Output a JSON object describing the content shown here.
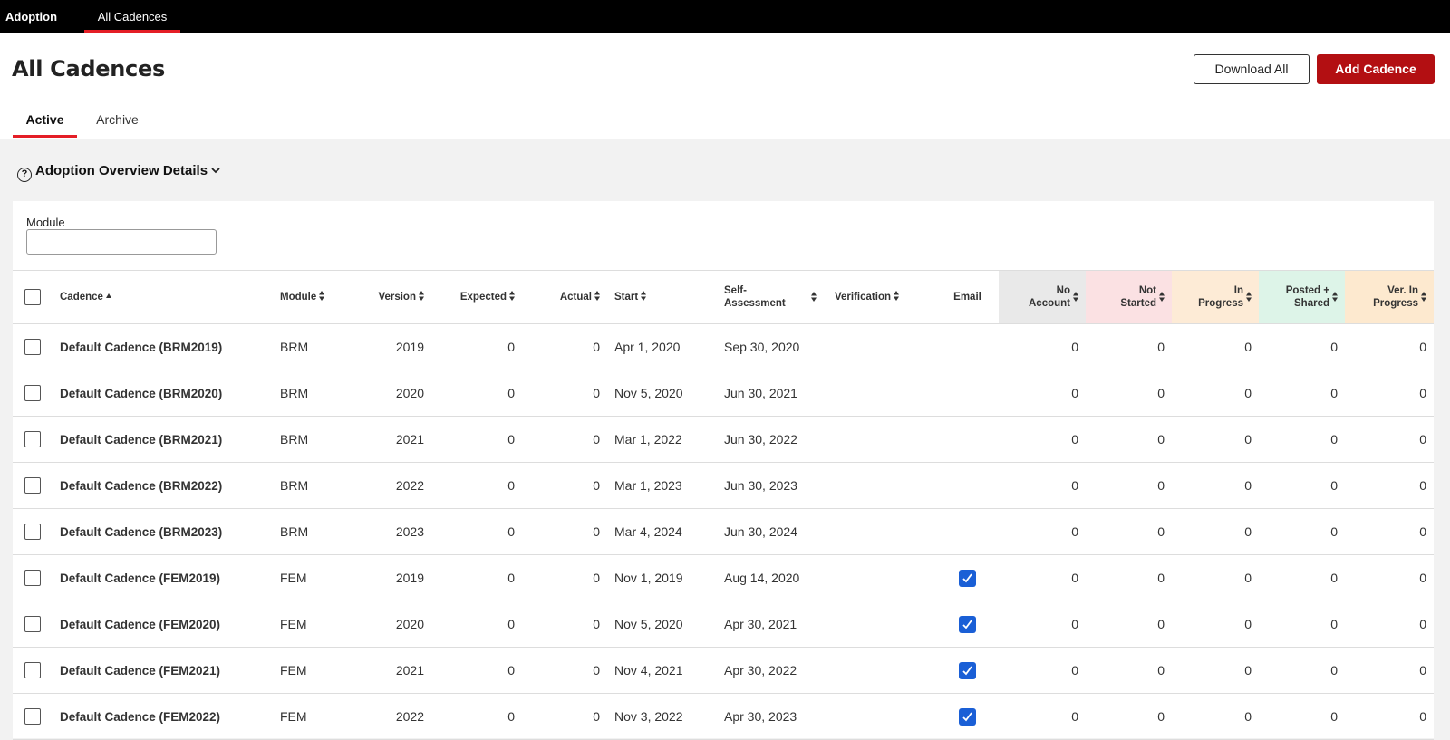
{
  "topnav": {
    "brand": "Adoption",
    "tab": "All Cadences"
  },
  "page": {
    "title": "All Cadences",
    "download_label": "Download All",
    "add_label": "Add Cadence"
  },
  "tabs": [
    {
      "label": "Active",
      "active": true
    },
    {
      "label": "Archive",
      "active": false
    }
  ],
  "overview": {
    "label": "Adoption Overview Details"
  },
  "filter": {
    "module_label": "Module",
    "module_value": ""
  },
  "colors": {
    "accent_red": "#e41e26",
    "button_red": "#b30f12",
    "checkbox_blue": "#1a5fd6",
    "no_account_bg": "#e9e9e9",
    "not_started_bg": "#fbe1e3",
    "in_progress_bg": "#fdebd6",
    "posted_shared_bg": "#ddf4e8",
    "ver_in_progress_bg": "#fde9cf"
  },
  "table": {
    "headers": {
      "cadence": "Cadence",
      "module": "Module",
      "version": "Version",
      "expected": "Expected",
      "actual": "Actual",
      "start": "Start",
      "self_assessment": "Self-Assessment",
      "verification": "Verification",
      "email": "Email",
      "no_account": "No Account",
      "not_started": "Not Started",
      "in_progress": "In Progress",
      "posted_shared": "Posted + Shared",
      "ver_in_progress": "Ver. In Progress"
    },
    "rows": [
      {
        "cadence": "Default Cadence (BRM2019)",
        "module": "BRM",
        "version": "2019",
        "expected": "0",
        "actual": "0",
        "start": "Apr 1, 2020",
        "self_assessment": "Sep 30, 2020",
        "verification": "",
        "email": false,
        "no_account": "0",
        "not_started": "0",
        "in_progress": "0",
        "posted_shared": "0",
        "ver_in_progress": "0"
      },
      {
        "cadence": "Default Cadence (BRM2020)",
        "module": "BRM",
        "version": "2020",
        "expected": "0",
        "actual": "0",
        "start": "Nov 5, 2020",
        "self_assessment": "Jun 30, 2021",
        "verification": "",
        "email": false,
        "no_account": "0",
        "not_started": "0",
        "in_progress": "0",
        "posted_shared": "0",
        "ver_in_progress": "0"
      },
      {
        "cadence": "Default Cadence (BRM2021)",
        "module": "BRM",
        "version": "2021",
        "expected": "0",
        "actual": "0",
        "start": "Mar 1, 2022",
        "self_assessment": "Jun 30, 2022",
        "verification": "",
        "email": false,
        "no_account": "0",
        "not_started": "0",
        "in_progress": "0",
        "posted_shared": "0",
        "ver_in_progress": "0"
      },
      {
        "cadence": "Default Cadence (BRM2022)",
        "module": "BRM",
        "version": "2022",
        "expected": "0",
        "actual": "0",
        "start": "Mar 1, 2023",
        "self_assessment": "Jun 30, 2023",
        "verification": "",
        "email": false,
        "no_account": "0",
        "not_started": "0",
        "in_progress": "0",
        "posted_shared": "0",
        "ver_in_progress": "0"
      },
      {
        "cadence": "Default Cadence (BRM2023)",
        "module": "BRM",
        "version": "2023",
        "expected": "0",
        "actual": "0",
        "start": "Mar 4, 2024",
        "self_assessment": "Jun 30, 2024",
        "verification": "",
        "email": false,
        "no_account": "0",
        "not_started": "0",
        "in_progress": "0",
        "posted_shared": "0",
        "ver_in_progress": "0"
      },
      {
        "cadence": "Default Cadence (FEM2019)",
        "module": "FEM",
        "version": "2019",
        "expected": "0",
        "actual": "0",
        "start": "Nov 1, 2019",
        "self_assessment": "Aug 14, 2020",
        "verification": "",
        "email": true,
        "no_account": "0",
        "not_started": "0",
        "in_progress": "0",
        "posted_shared": "0",
        "ver_in_progress": "0"
      },
      {
        "cadence": "Default Cadence (FEM2020)",
        "module": "FEM",
        "version": "2020",
        "expected": "0",
        "actual": "0",
        "start": "Nov 5, 2020",
        "self_assessment": "Apr 30, 2021",
        "verification": "",
        "email": true,
        "no_account": "0",
        "not_started": "0",
        "in_progress": "0",
        "posted_shared": "0",
        "ver_in_progress": "0"
      },
      {
        "cadence": "Default Cadence (FEM2021)",
        "module": "FEM",
        "version": "2021",
        "expected": "0",
        "actual": "0",
        "start": "Nov 4, 2021",
        "self_assessment": "Apr 30, 2022",
        "verification": "",
        "email": true,
        "no_account": "0",
        "not_started": "0",
        "in_progress": "0",
        "posted_shared": "0",
        "ver_in_progress": "0"
      },
      {
        "cadence": "Default Cadence (FEM2022)",
        "module": "FEM",
        "version": "2022",
        "expected": "0",
        "actual": "0",
        "start": "Nov 3, 2022",
        "self_assessment": "Apr 30, 2023",
        "verification": "",
        "email": true,
        "no_account": "0",
        "not_started": "0",
        "in_progress": "0",
        "posted_shared": "0",
        "ver_in_progress": "0"
      }
    ]
  }
}
